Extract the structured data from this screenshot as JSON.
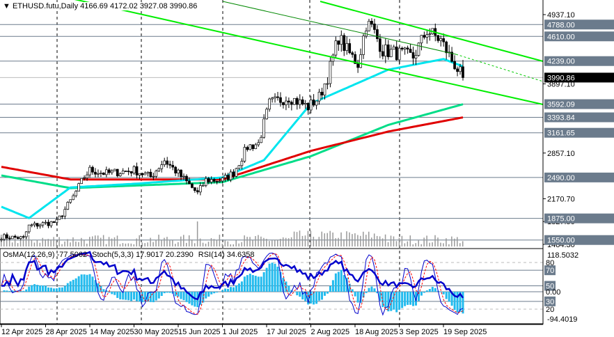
{
  "header": {
    "symbol": "ETHUSD.futu,Daily",
    "open": "4166.69",
    "high": "4172.02",
    "low": "3927.08",
    "close": "3990.86"
  },
  "indicator_header": {
    "osma": "OsMA(12,26,9) -77.5062",
    "stoch": "Stoch(5,3,3) 17.9017 20.2390",
    "rsi": "RSI(14) 34.6358"
  },
  "colors": {
    "ma_fast": "#00e5ee",
    "ma_mid": "#00dd88",
    "ma_slow": "#e00000",
    "channel": "#00ee00",
    "level": "#6b7b8c",
    "histogram": "#22bbee",
    "rsi": "#0000cc",
    "stoch_signal": "#ff0000"
  },
  "chart_data": {
    "type": "candlestick",
    "title": "ETHUSD.futu, Daily",
    "start_date": "12 Apr 2025",
    "close_keypoints": [
      [
        0,
        1600
      ],
      [
        8,
        1580
      ],
      [
        10,
        1760
      ],
      [
        16,
        1800
      ],
      [
        20,
        1820
      ],
      [
        26,
        2200
      ],
      [
        30,
        2500
      ],
      [
        32,
        2600
      ],
      [
        38,
        2550
      ],
      [
        48,
        2600
      ],
      [
        54,
        2500
      ],
      [
        59,
        2750
      ],
      [
        64,
        2550
      ],
      [
        71,
        2250
      ],
      [
        74,
        2450
      ],
      [
        80,
        2450
      ],
      [
        84,
        2560
      ],
      [
        89,
        2950
      ],
      [
        93,
        3000
      ],
      [
        97,
        3600
      ],
      [
        104,
        3700
      ],
      [
        111,
        3550
      ],
      [
        115,
        3700
      ],
      [
        118,
        4000
      ],
      [
        122,
        4600
      ],
      [
        125,
        4400
      ],
      [
        129,
        4200
      ],
      [
        132,
        4800
      ],
      [
        134,
        4750
      ],
      [
        138,
        4400
      ],
      [
        144,
        4350
      ],
      [
        149,
        4300
      ],
      [
        154,
        4700
      ],
      [
        159,
        4550
      ],
      [
        163,
        4250
      ],
      [
        167,
        3990.86
      ]
    ],
    "ma_fast_keypoints": [
      [
        0,
        2050
      ],
      [
        10,
        1880
      ],
      [
        25,
        2340
      ],
      [
        50,
        2400
      ],
      [
        80,
        2490
      ],
      [
        95,
        2750
      ],
      [
        112,
        3600
      ],
      [
        140,
        4110
      ],
      [
        160,
        4270
      ],
      [
        167,
        4160
      ]
    ],
    "ma_mid_keypoints": [
      [
        0,
        2520
      ],
      [
        25,
        2330
      ],
      [
        80,
        2420
      ],
      [
        112,
        2810
      ],
      [
        140,
        3280
      ],
      [
        167,
        3590
      ]
    ],
    "ma_slow_keypoints": [
      [
        0,
        2650
      ],
      [
        25,
        2460
      ],
      [
        80,
        2460
      ],
      [
        112,
        2890
      ],
      [
        140,
        3180
      ],
      [
        167,
        3393
      ]
    ],
    "price_levels": [
      "4788.00",
      "4610.00",
      "4239.00",
      "3592.09",
      "3393.84",
      "3161.65",
      "2490.00",
      "1875.00",
      "1550.00"
    ],
    "current_price": "3990.86",
    "y_ticks": [
      "4937.10",
      "3897.10",
      "2857.10",
      "2170.70",
      "1827.50",
      "1484.30"
    ],
    "ylim": [
      1484.3,
      4937.1
    ],
    "x_ticks": [
      "12 Apr 2025",
      "28 Apr 2025",
      "14 May 2025",
      "30 May 2025",
      "15 Jun 2025",
      "1 Jul 2025",
      "17 Jul 2025",
      "2 Aug 2025",
      "18 Aug 2025",
      "3 Sep 2025",
      "19 Sep 2025"
    ],
    "indicator_scale": {
      "max": "118.5032",
      "min": "-94.4019",
      "zero": "0.00",
      "levels": [
        "80",
        "70",
        "50",
        "30",
        "20"
      ]
    }
  }
}
